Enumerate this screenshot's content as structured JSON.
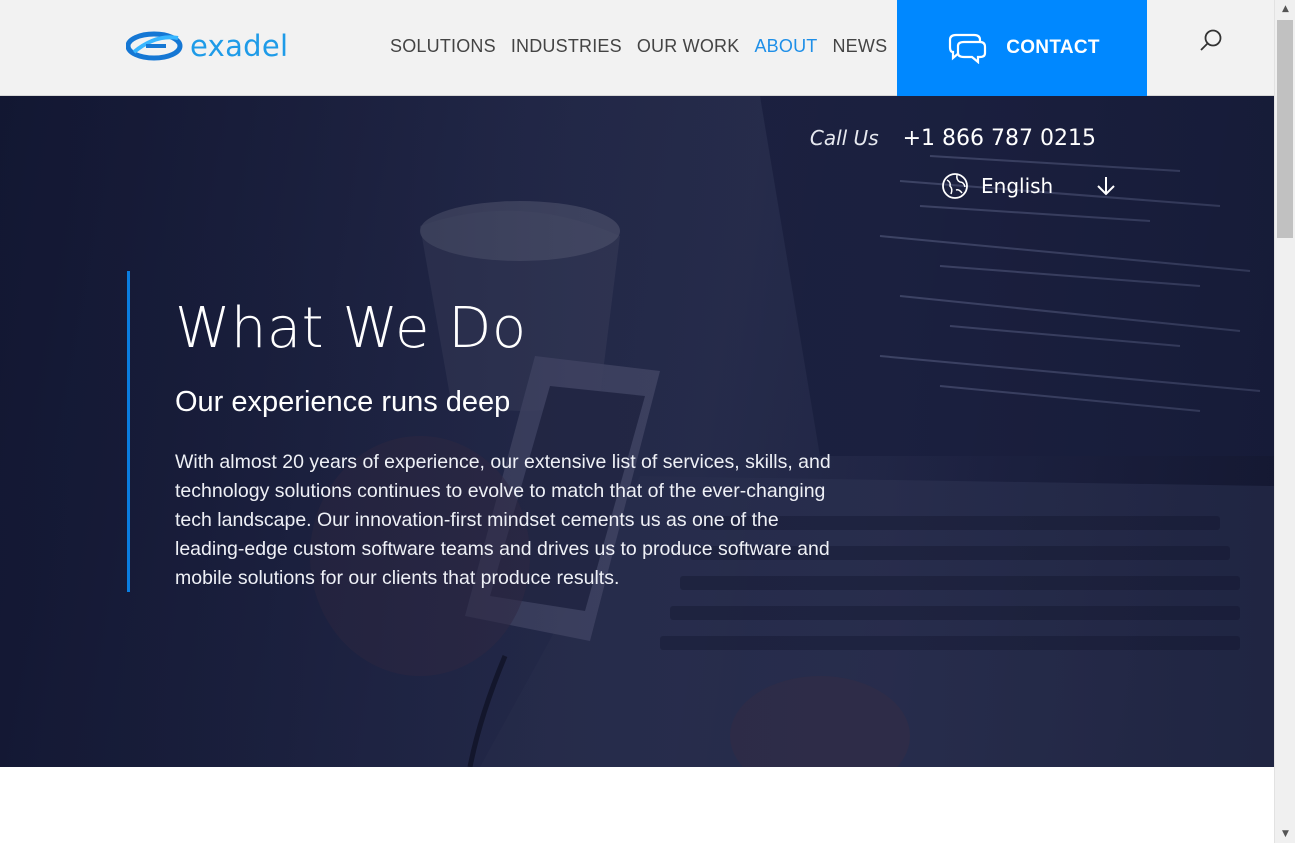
{
  "brand": {
    "logo_text": "exadel",
    "colors": {
      "accent": "#0088ff",
      "nav_active": "#1e8fe8",
      "logo": "#1e9be8"
    }
  },
  "nav": {
    "items": [
      {
        "label": "SOLUTIONS",
        "active": false
      },
      {
        "label": "INDUSTRIES",
        "active": false
      },
      {
        "label": "OUR WORK",
        "active": false
      },
      {
        "label": "ABOUT",
        "active": true
      },
      {
        "label": "NEWS",
        "active": false
      }
    ],
    "contact_label": "CONTACT",
    "contact_icon": "chat-bubbles-icon",
    "search_icon": "search-icon"
  },
  "hero": {
    "call_label": "Call Us",
    "phone": "+1 866 787 0215",
    "language": "English",
    "language_icon": "globe-icon",
    "title": "What We Do",
    "subtitle": "Our experience runs deep",
    "body": "With almost 20 years of experience, our extensive list of services, skills, and technology solutions continues to evolve to match that of the ever-changing tech landscape. Our innovation-first mindset cements us as one of the leading-edge custom software teams and drives us to produce software and mobile solutions for our clients that produce results."
  }
}
